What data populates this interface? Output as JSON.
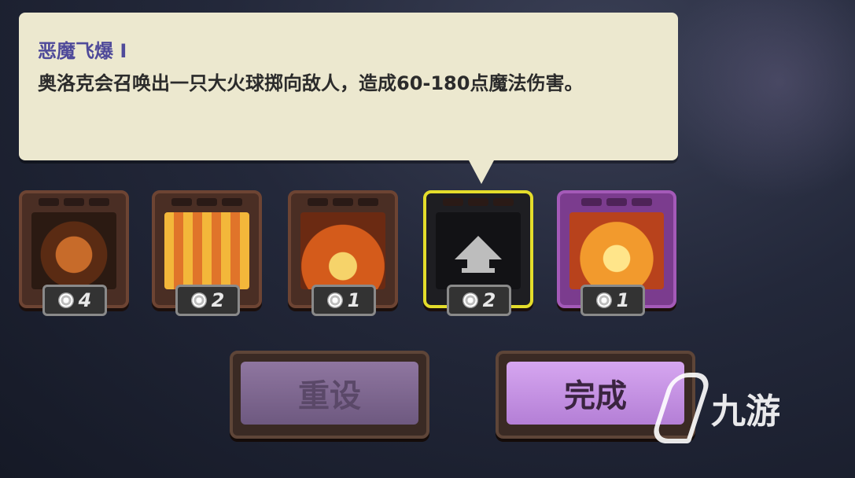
{
  "tooltip": {
    "title": "恶魔飞爆 I",
    "description": "奥洛克会召唤出一只大火球掷向敌人，造成60-180点魔法伤害。"
  },
  "skills": [
    {
      "cost": "4",
      "icon": "demon-summon-icon"
    },
    {
      "cost": "2",
      "icon": "lava-burst-icon"
    },
    {
      "cost": "1",
      "icon": "fire-tower-icon"
    },
    {
      "cost": "2",
      "icon": "upgrade-arrow-icon",
      "selected": true
    },
    {
      "cost": "1",
      "icon": "skull-fire-icon",
      "ultimate": true
    }
  ],
  "buttons": {
    "reset_label": "重设",
    "done_label": "完成"
  },
  "watermark": {
    "text": "九游"
  },
  "colors": {
    "tooltip_bg": "#ece8cf",
    "title": "#4f4a9a",
    "selected_border": "#e4dd2b",
    "done_button": "#c993e8"
  }
}
